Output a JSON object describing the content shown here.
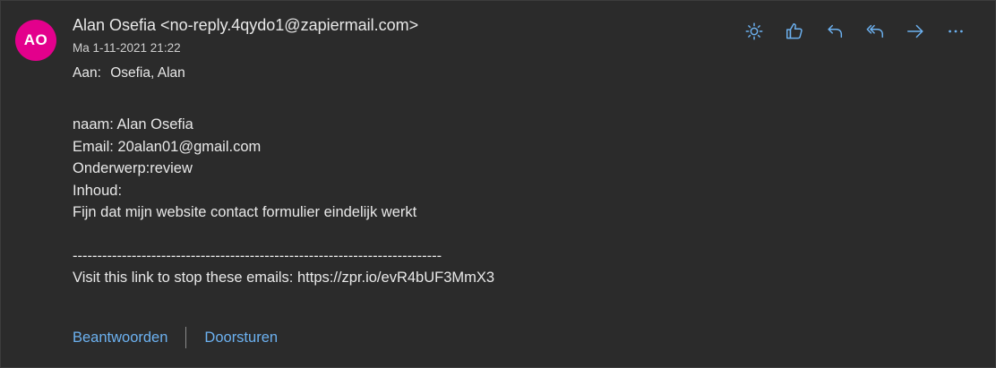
{
  "sender": {
    "initials": "AO",
    "display": "Alan Osefia <no-reply.4qydo1@zapiermail.com>",
    "avatar_color": "#e3008c"
  },
  "date": "Ma 1-11-2021 21:22",
  "recipient": {
    "label": "Aan:",
    "value": "Osefia, Alan"
  },
  "toolbar": [
    {
      "icon": "sun-icon",
      "name": "brightness-button"
    },
    {
      "icon": "thumbs-up-icon",
      "name": "like-button"
    },
    {
      "icon": "reply-icon",
      "name": "reply-button"
    },
    {
      "icon": "reply-all-icon",
      "name": "reply-all-button"
    },
    {
      "icon": "forward-icon",
      "name": "forward-button"
    },
    {
      "icon": "more-icon",
      "name": "more-actions-button"
    }
  ],
  "body": {
    "lines_1": [
      "naam: Alan Osefia",
      "Email: 20alan01@gmail.com",
      "Onderwerp:review",
      "Inhoud:",
      "Fijn dat mijn website contact formulier eindelijk werkt"
    ],
    "separator": "---------------------------------------------------------------------------",
    "footer": "Visit this link to stop these emails: https://zpr.io/evR4bUF3MmX3"
  },
  "actions": {
    "reply": "Beantwoorden",
    "forward": "Doorsturen"
  },
  "colors": {
    "background": "#2b2b2b",
    "text": "#e8e8e8",
    "accent": "#6cb1f0"
  }
}
